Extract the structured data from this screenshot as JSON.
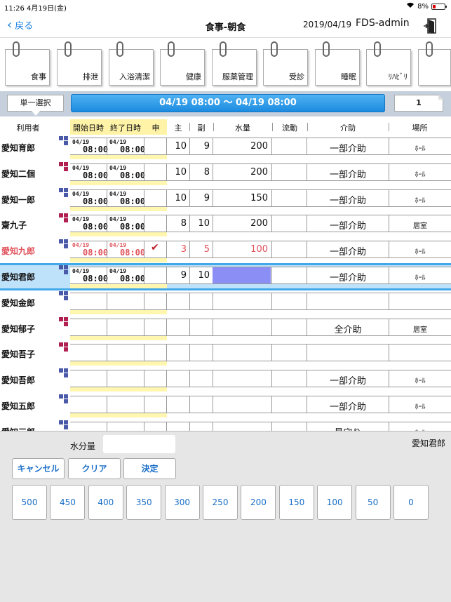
{
  "status": {
    "time": "11:26",
    "date": "4月19日(金)",
    "battery": "8%"
  },
  "nav": {
    "back": "戻る",
    "title": "食事-朝食",
    "date": "2019/04/19",
    "user": "FDS-admin"
  },
  "categories": [
    "食事",
    "排泄",
    "入浴清潔",
    "健康",
    "服薬管理",
    "受診",
    "睡眠",
    "ﾘﾊﾋﾞﾘ",
    ""
  ],
  "selection": {
    "single": "単一選択",
    "range": "04/19 08:00 〜 04/19 08:00",
    "page": "1"
  },
  "headers": {
    "user": "利用者",
    "start": "開始日時",
    "end": "終了日時",
    "apply": "申",
    "main": "主",
    "side": "副",
    "water": "水量",
    "fluid": "流動",
    "assist": "介助",
    "place": "場所"
  },
  "rows": [
    {
      "name": "愛知育郎",
      "mark": "blue",
      "sd": "04/19",
      "st": "08:00",
      "ed": "04/19",
      "et": "08:00",
      "main": "10",
      "side": "9",
      "water": "200",
      "assist": "一部介助",
      "place": "ﾎｰﾙ"
    },
    {
      "name": "愛知二個",
      "mark": "red",
      "sd": "04/19",
      "st": "08:00",
      "ed": "04/19",
      "et": "08:00",
      "main": "10",
      "side": "8",
      "water": "200",
      "assist": "一部介助",
      "place": "ﾎｰﾙ"
    },
    {
      "name": "愛知一郎",
      "mark": "blue",
      "sd": "04/19",
      "st": "08:00",
      "ed": "04/19",
      "et": "08:00",
      "main": "10",
      "side": "9",
      "water": "150",
      "assist": "一部介助",
      "place": "ﾎｰﾙ"
    },
    {
      "name": "齋九子",
      "mark": "red",
      "sd": "04/19",
      "st": "08:00",
      "ed": "04/19",
      "et": "08:00",
      "main": "8",
      "side": "10",
      "water": "200",
      "assist": "一部介助",
      "place": "居室"
    },
    {
      "name": "愛知九郎",
      "mark": "blue",
      "sd": "04/19",
      "st": "08:00",
      "ed": "04/19",
      "et": "08:00",
      "check": "✔",
      "main": "3",
      "side": "5",
      "water": "100",
      "assist": "一部介助",
      "place": "ﾎｰﾙ"
    },
    {
      "name": "愛知君郎",
      "mark": "blue",
      "sd": "04/19",
      "st": "08:00",
      "ed": "04/19",
      "et": "08:00",
      "main": "9",
      "side": "10",
      "water": "",
      "assist": "一部介助",
      "place": "ﾎｰﾙ"
    },
    {
      "name": "愛知金郎",
      "mark": "blue",
      "sd": "",
      "st": "",
      "ed": "",
      "et": "",
      "main": "",
      "side": "",
      "water": "",
      "assist": "",
      "place": ""
    },
    {
      "name": "愛知郁子",
      "mark": "red",
      "sd": "",
      "st": "",
      "ed": "",
      "et": "",
      "main": "",
      "side": "",
      "water": "",
      "assist": "全介助",
      "place": "居室"
    },
    {
      "name": "愛知吾子",
      "mark": "red",
      "sd": "",
      "st": "",
      "ed": "",
      "et": "",
      "main": "",
      "side": "",
      "water": "",
      "assist": "",
      "place": ""
    },
    {
      "name": "愛知吾郎",
      "mark": "blue",
      "sd": "",
      "st": "",
      "ed": "",
      "et": "",
      "main": "",
      "side": "",
      "water": "",
      "assist": "一部介助",
      "place": "ﾎｰﾙ"
    },
    {
      "name": "愛知五郎",
      "mark": "blue",
      "sd": "",
      "st": "",
      "ed": "",
      "et": "",
      "main": "",
      "side": "",
      "water": "",
      "assist": "一部介助",
      "place": "ﾎｰﾙ"
    },
    {
      "name": "愛知三郎",
      "mark": "blue",
      "sd": "",
      "st": "",
      "ed": "",
      "et": "",
      "main": "",
      "side": "",
      "water": "",
      "assist": "見守り",
      "place": "ﾎｰﾙ"
    }
  ],
  "panel": {
    "water_label": "水分量",
    "water_value": "",
    "person": "愛知君郎",
    "cancel": "キャンセル",
    "clear": "クリア",
    "ok": "決定",
    "numbers": [
      "500",
      "450",
      "400",
      "350",
      "300",
      "250",
      "200",
      "150",
      "100",
      "50",
      "0"
    ]
  },
  "colors": {
    "accent": "#1a7ee0",
    "range_bar": "#1c8be0",
    "alert": "#e0525a",
    "water_active": "#8a8ef5",
    "mark_blue": "#4a5aa8",
    "mark_red": "#b02050"
  }
}
